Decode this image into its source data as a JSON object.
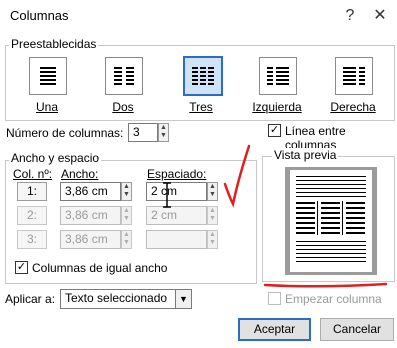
{
  "window": {
    "title": "Columnas",
    "help": "?",
    "close": "✕"
  },
  "presets": {
    "label": "Preestablecidas",
    "items": [
      {
        "label": "Una",
        "cols": 1,
        "selected": false
      },
      {
        "label": "Dos",
        "cols": 2,
        "selected": false
      },
      {
        "label": "Tres",
        "cols": 3,
        "selected": true
      },
      {
        "label": "Izquierda",
        "cols": 2,
        "selected": false
      },
      {
        "label": "Derecha",
        "cols": 2,
        "selected": false
      }
    ]
  },
  "num_cols": {
    "label": "Número de columnas:",
    "value": "3"
  },
  "line_between": {
    "label": "Línea entre columnas",
    "checked": true
  },
  "width_spacing": {
    "label": "Ancho y espacio",
    "col_header": "Col. nº:",
    "width_header": "Ancho:",
    "spacing_header": "Espaciado:",
    "rows": [
      {
        "col": "1:",
        "width": "3,86 cm",
        "spacing": "2 cm"
      },
      {
        "col": "2:",
        "width": "3,86 cm",
        "spacing": "2 cm"
      },
      {
        "col": "3:",
        "width": "3,86 cm",
        "spacing": ""
      }
    ]
  },
  "equal_width": {
    "label": "Columnas de igual ancho",
    "checked": true
  },
  "apply_to": {
    "label": "Aplicar a:",
    "value": "Texto seleccionado"
  },
  "preview": {
    "label": "Vista previa"
  },
  "new_column": {
    "label": "Empezar columna",
    "checked": false
  },
  "buttons": {
    "ok": "Aceptar",
    "cancel": "Cancelar"
  },
  "colors": {
    "annotation_red": "#e02020",
    "accent": "#2b6cc4"
  }
}
